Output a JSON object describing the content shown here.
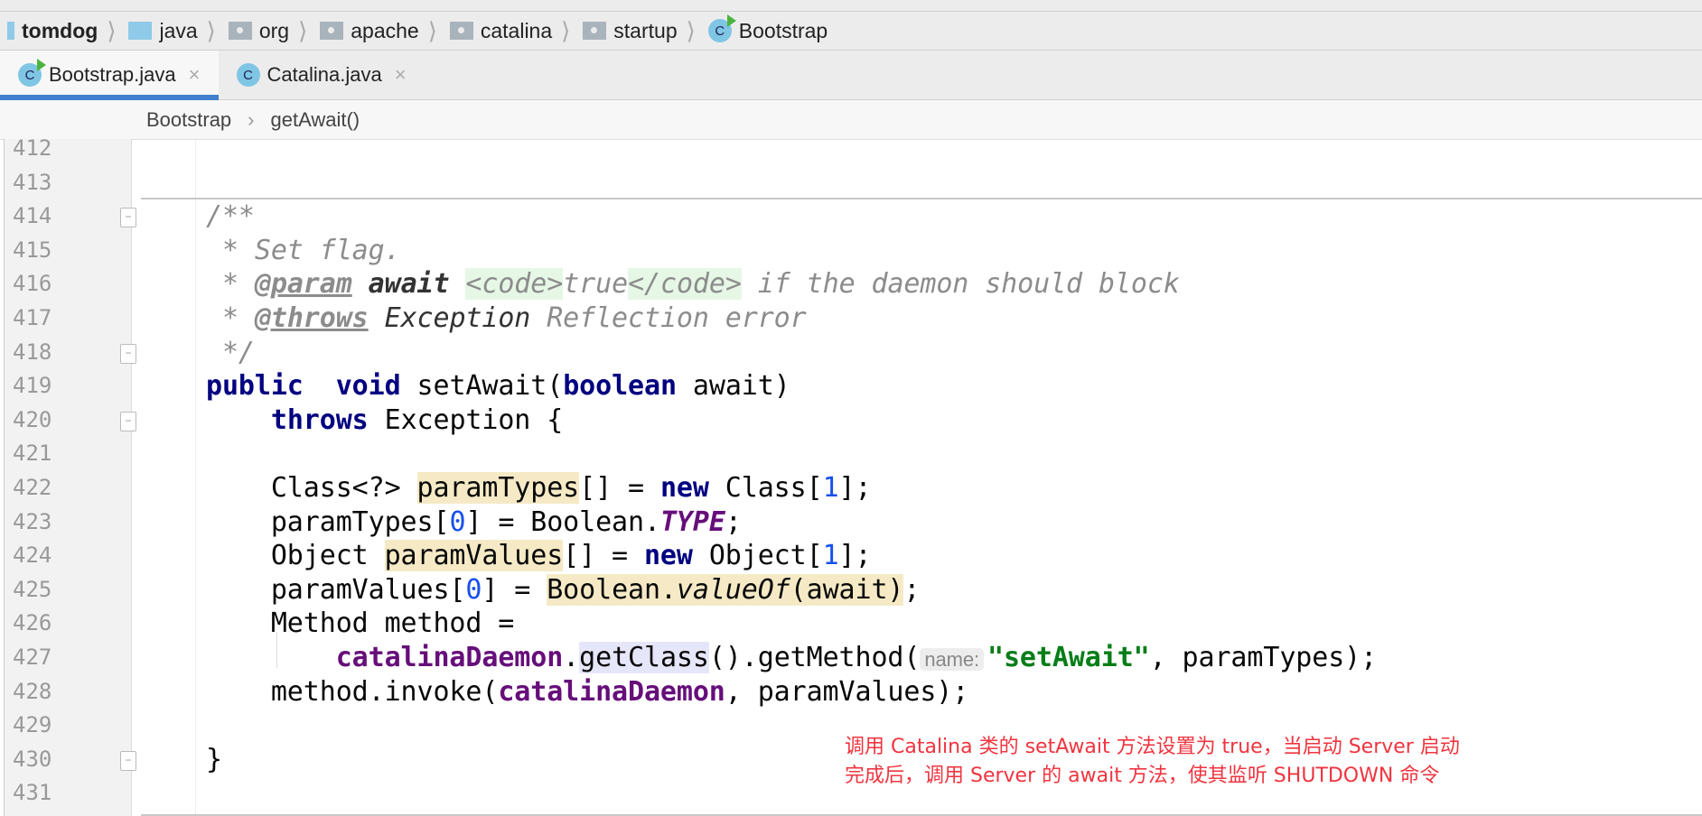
{
  "navbar": {
    "items": [
      {
        "label": "tomdog",
        "icon": "module-icon"
      },
      {
        "label": "java",
        "icon": "source-folder-icon"
      },
      {
        "label": "org",
        "icon": "package-icon"
      },
      {
        "label": "apache",
        "icon": "package-icon"
      },
      {
        "label": "catalina",
        "icon": "package-icon"
      },
      {
        "label": "startup",
        "icon": "package-icon"
      },
      {
        "label": "Bootstrap",
        "icon": "runnable-class-icon"
      }
    ]
  },
  "tabs": [
    {
      "label": "Bootstrap.java",
      "active": true,
      "icon": "runnable-class-icon",
      "close": "×"
    },
    {
      "label": "Catalina.java",
      "active": false,
      "icon": "class-icon",
      "close": "×"
    }
  ],
  "subcrumb": {
    "class": "Bootstrap",
    "sep": "›",
    "method": "getAwait()"
  },
  "class_icon_letter": "C",
  "lines": [
    {
      "n": "412",
      "t": []
    },
    {
      "n": "413",
      "t": []
    },
    {
      "n": "414",
      "fold": true,
      "t": [
        [
          "cm",
          "/**"
        ]
      ]
    },
    {
      "n": "415",
      "t": [
        [
          "cm",
          " * Set flag."
        ]
      ]
    },
    {
      "n": "416",
      "t": [
        [
          "cm",
          " * "
        ],
        [
          "tag",
          "@param"
        ],
        [
          "cm",
          " "
        ],
        [
          "cmb",
          "await"
        ],
        [
          "cm",
          " "
        ],
        [
          "html",
          "<code>"
        ],
        [
          "cm",
          "true"
        ],
        [
          "html",
          "</code>"
        ],
        [
          "cm",
          " if the daemon should block"
        ]
      ]
    },
    {
      "n": "417",
      "t": [
        [
          "cm",
          " * "
        ],
        [
          "tag",
          "@throws"
        ],
        [
          "cm",
          " "
        ],
        [
          "cmn",
          "Exception"
        ],
        [
          "cm",
          " Reflection error"
        ]
      ]
    },
    {
      "n": "418",
      "fold": true,
      "t": [
        [
          "cm",
          " */"
        ]
      ]
    },
    {
      "n": "419",
      "t": [
        [
          "kw",
          "public"
        ],
        [
          "",
          "  "
        ],
        [
          "kw",
          "void"
        ],
        [
          "",
          " setAwait("
        ],
        [
          "kw",
          "boolean"
        ],
        [
          "",
          " await)"
        ]
      ]
    },
    {
      "n": "420",
      "fold": true,
      "t": [
        [
          "",
          "    "
        ],
        [
          "kw",
          "throws"
        ],
        [
          "",
          " Exception {"
        ]
      ]
    },
    {
      "n": "421",
      "t": []
    },
    {
      "n": "422",
      "t": [
        [
          "",
          "    Class<?> "
        ],
        [
          "hl",
          "paramTypes"
        ],
        [
          "",
          "[] = "
        ],
        [
          "kw",
          "new"
        ],
        [
          "",
          " Class["
        ],
        [
          "num",
          "1"
        ],
        [
          "",
          "];"
        ]
      ]
    },
    {
      "n": "423",
      "t": [
        [
          "",
          "    paramTypes["
        ],
        [
          "num",
          "0"
        ],
        [
          "",
          "] = Boolean."
        ],
        [
          "st",
          "TYPE"
        ],
        [
          "",
          ";"
        ]
      ]
    },
    {
      "n": "424",
      "t": [
        [
          "",
          "    Object "
        ],
        [
          "hl",
          "paramValues"
        ],
        [
          "",
          "[] = "
        ],
        [
          "kw",
          "new"
        ],
        [
          "",
          " Object["
        ],
        [
          "num",
          "1"
        ],
        [
          "",
          "];"
        ]
      ]
    },
    {
      "n": "425",
      "t": [
        [
          "",
          "    paramValues["
        ],
        [
          "num",
          "0"
        ],
        [
          "",
          "] = "
        ],
        [
          "hl",
          "Boolean."
        ],
        [
          "hl it",
          "valueOf"
        ],
        [
          "hl",
          "(await)"
        ],
        [
          "",
          ";"
        ]
      ]
    },
    {
      "n": "426",
      "t": [
        [
          "",
          "    Method method ="
        ]
      ]
    },
    {
      "n": "427",
      "t": [
        [
          "",
          "        "
        ],
        [
          "fld",
          "catalinaDaemon"
        ],
        [
          "",
          "."
        ],
        [
          "hl2",
          "getClass"
        ],
        [
          "",
          "().getMethod("
        ],
        [
          "hint",
          "name:"
        ],
        [
          "str",
          "\"setAwait\""
        ],
        [
          "",
          ", paramTypes);"
        ]
      ]
    },
    {
      "n": "428",
      "t": [
        [
          "",
          "    method.invoke("
        ],
        [
          "fld",
          "catalinaDaemon"
        ],
        [
          "",
          ", paramValues);"
        ]
      ]
    },
    {
      "n": "429",
      "t": []
    },
    {
      "n": "430",
      "fold": true,
      "t": [
        [
          "",
          "}"
        ]
      ]
    },
    {
      "n": "431",
      "t": []
    }
  ],
  "annotation": {
    "line1": "调用 Catalina 类的 setAwait 方法设置为 true，当启动 Server 启动",
    "line2": "完成后，调用 Server 的 await 方法，使其监听 SHUTDOWN 命令",
    "color": "#f0343f"
  }
}
